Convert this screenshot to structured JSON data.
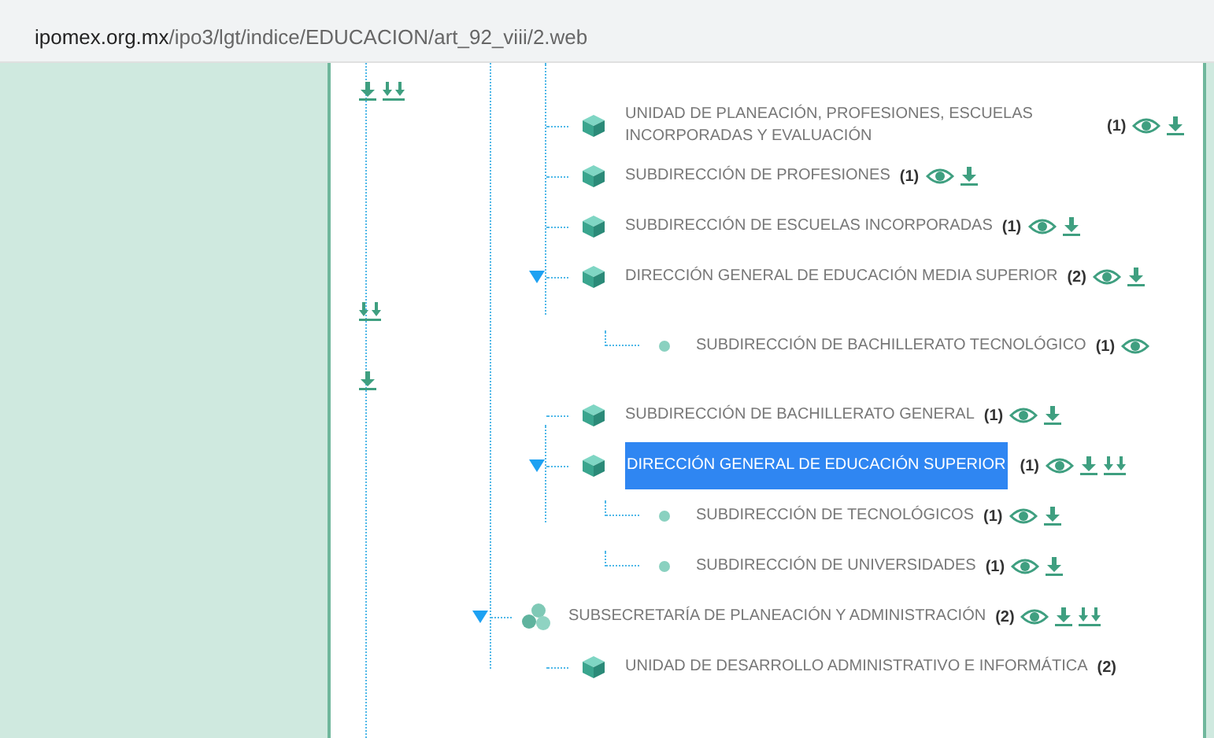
{
  "address_bar": {
    "domain": "ipomex.org.mx",
    "path": "/ipo3/lgt/indice/EDUCACION/art_92_viii/2.web"
  },
  "tree": [
    {
      "kind": "tail",
      "has_view": false,
      "has_download": true,
      "has_download_all": true
    },
    {
      "kind": "group",
      "children": [
        {
          "kind": "cube",
          "label": "UNIDAD DE PLANEACIÓN, PROFESIONES, ESCUELAS INCORPORADAS Y EVALUACIÓN",
          "count": "(1)",
          "has_view": true,
          "has_download": true,
          "has_download_all": false,
          "expanded": false,
          "selected": false
        },
        {
          "kind": "cube",
          "label": "SUBDIRECCIÓN DE PROFESIONES",
          "count": "(1)",
          "has_view": true,
          "has_download": true,
          "has_download_all": false,
          "expanded": false,
          "selected": false
        },
        {
          "kind": "cube",
          "label": "SUBDIRECCIÓN DE ESCUELAS INCORPORADAS",
          "count": "(1)",
          "has_view": true,
          "has_download": true,
          "has_download_all": false,
          "expanded": false,
          "selected": false
        },
        {
          "kind": "cube",
          "label": "DIRECCIÓN GENERAL DE EDUCACIÓN MEDIA SUPERIOR",
          "count": "(2)",
          "has_view": true,
          "has_download": true,
          "has_download_all": false,
          "expanded": true,
          "selected": false,
          "children": [
            {
              "kind": "tail",
              "has_view": false,
              "has_download": false,
              "has_download_all": true
            },
            {
              "kind": "dot",
              "label": "SUBDIRECCIÓN DE BACHILLERATO TECNOLÓGICO",
              "count": "(1)",
              "has_view": true,
              "has_download": false,
              "has_download_all": false,
              "expanded": false,
              "selected": false
            },
            {
              "kind": "tail",
              "has_view": false,
              "has_download": true,
              "has_download_all": false
            }
          ]
        },
        {
          "kind": "cube",
          "label": "SUBDIRECCIÓN DE BACHILLERATO GENERAL",
          "count": "(1)",
          "has_view": true,
          "has_download": true,
          "has_download_all": false,
          "expanded": false,
          "selected": false
        },
        {
          "kind": "cube",
          "label": "DIRECCIÓN GENERAL DE EDUCACIÓN SUPERIOR",
          "count": "(1)",
          "has_view": true,
          "has_download": true,
          "has_download_all": true,
          "expanded": true,
          "selected": true,
          "children": [
            {
              "kind": "dot",
              "label": "SUBDIRECCIÓN DE TECNOLÓGICOS",
              "count": "(1)",
              "has_view": true,
              "has_download": true,
              "has_download_all": false,
              "expanded": false,
              "selected": false
            },
            {
              "kind": "dot",
              "label": "SUBDIRECCIÓN DE UNIVERSIDADES",
              "count": "(1)",
              "has_view": true,
              "has_download": true,
              "has_download_all": false,
              "expanded": false,
              "selected": false
            }
          ]
        }
      ]
    },
    {
      "kind": "cluster",
      "label": "SUBSECRETARÍA DE PLANEACIÓN Y ADMINISTRACIÓN",
      "count": "(2)",
      "has_view": true,
      "has_download": true,
      "has_download_all": true,
      "expanded": true,
      "selected": false,
      "children": [
        {
          "kind": "cube",
          "label": "UNIDAD DE DESARROLLO ADMINISTRATIVO E INFORMÁTICA",
          "count": "(2)",
          "has_view": false,
          "has_download": false,
          "has_download_all": false,
          "expanded": false,
          "selected": false
        }
      ]
    }
  ]
}
